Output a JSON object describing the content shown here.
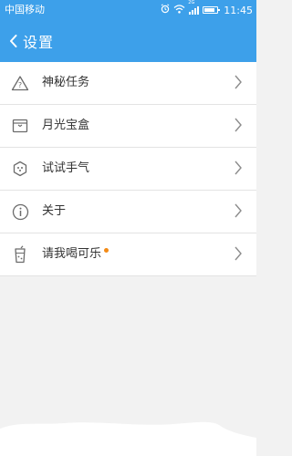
{
  "status_bar": {
    "carrier": "中国移动",
    "network": "2G",
    "time": "11:45"
  },
  "header": {
    "title": "设置",
    "back_icon": "chevron-left-icon"
  },
  "menu": {
    "items": [
      {
        "label": "神秘任务",
        "icon": "warning-triangle-icon"
      },
      {
        "label": "月光宝盒",
        "icon": "box-icon"
      },
      {
        "label": "试试手气",
        "icon": "dice-icon"
      },
      {
        "label": "关于",
        "icon": "info-icon"
      },
      {
        "label": "请我喝可乐",
        "icon": "cola-cup-icon",
        "badge": "new-dot"
      }
    ]
  },
  "colors": {
    "header": "#3da0ea",
    "badge": "#f38a15",
    "background": "#f2f2f2"
  }
}
